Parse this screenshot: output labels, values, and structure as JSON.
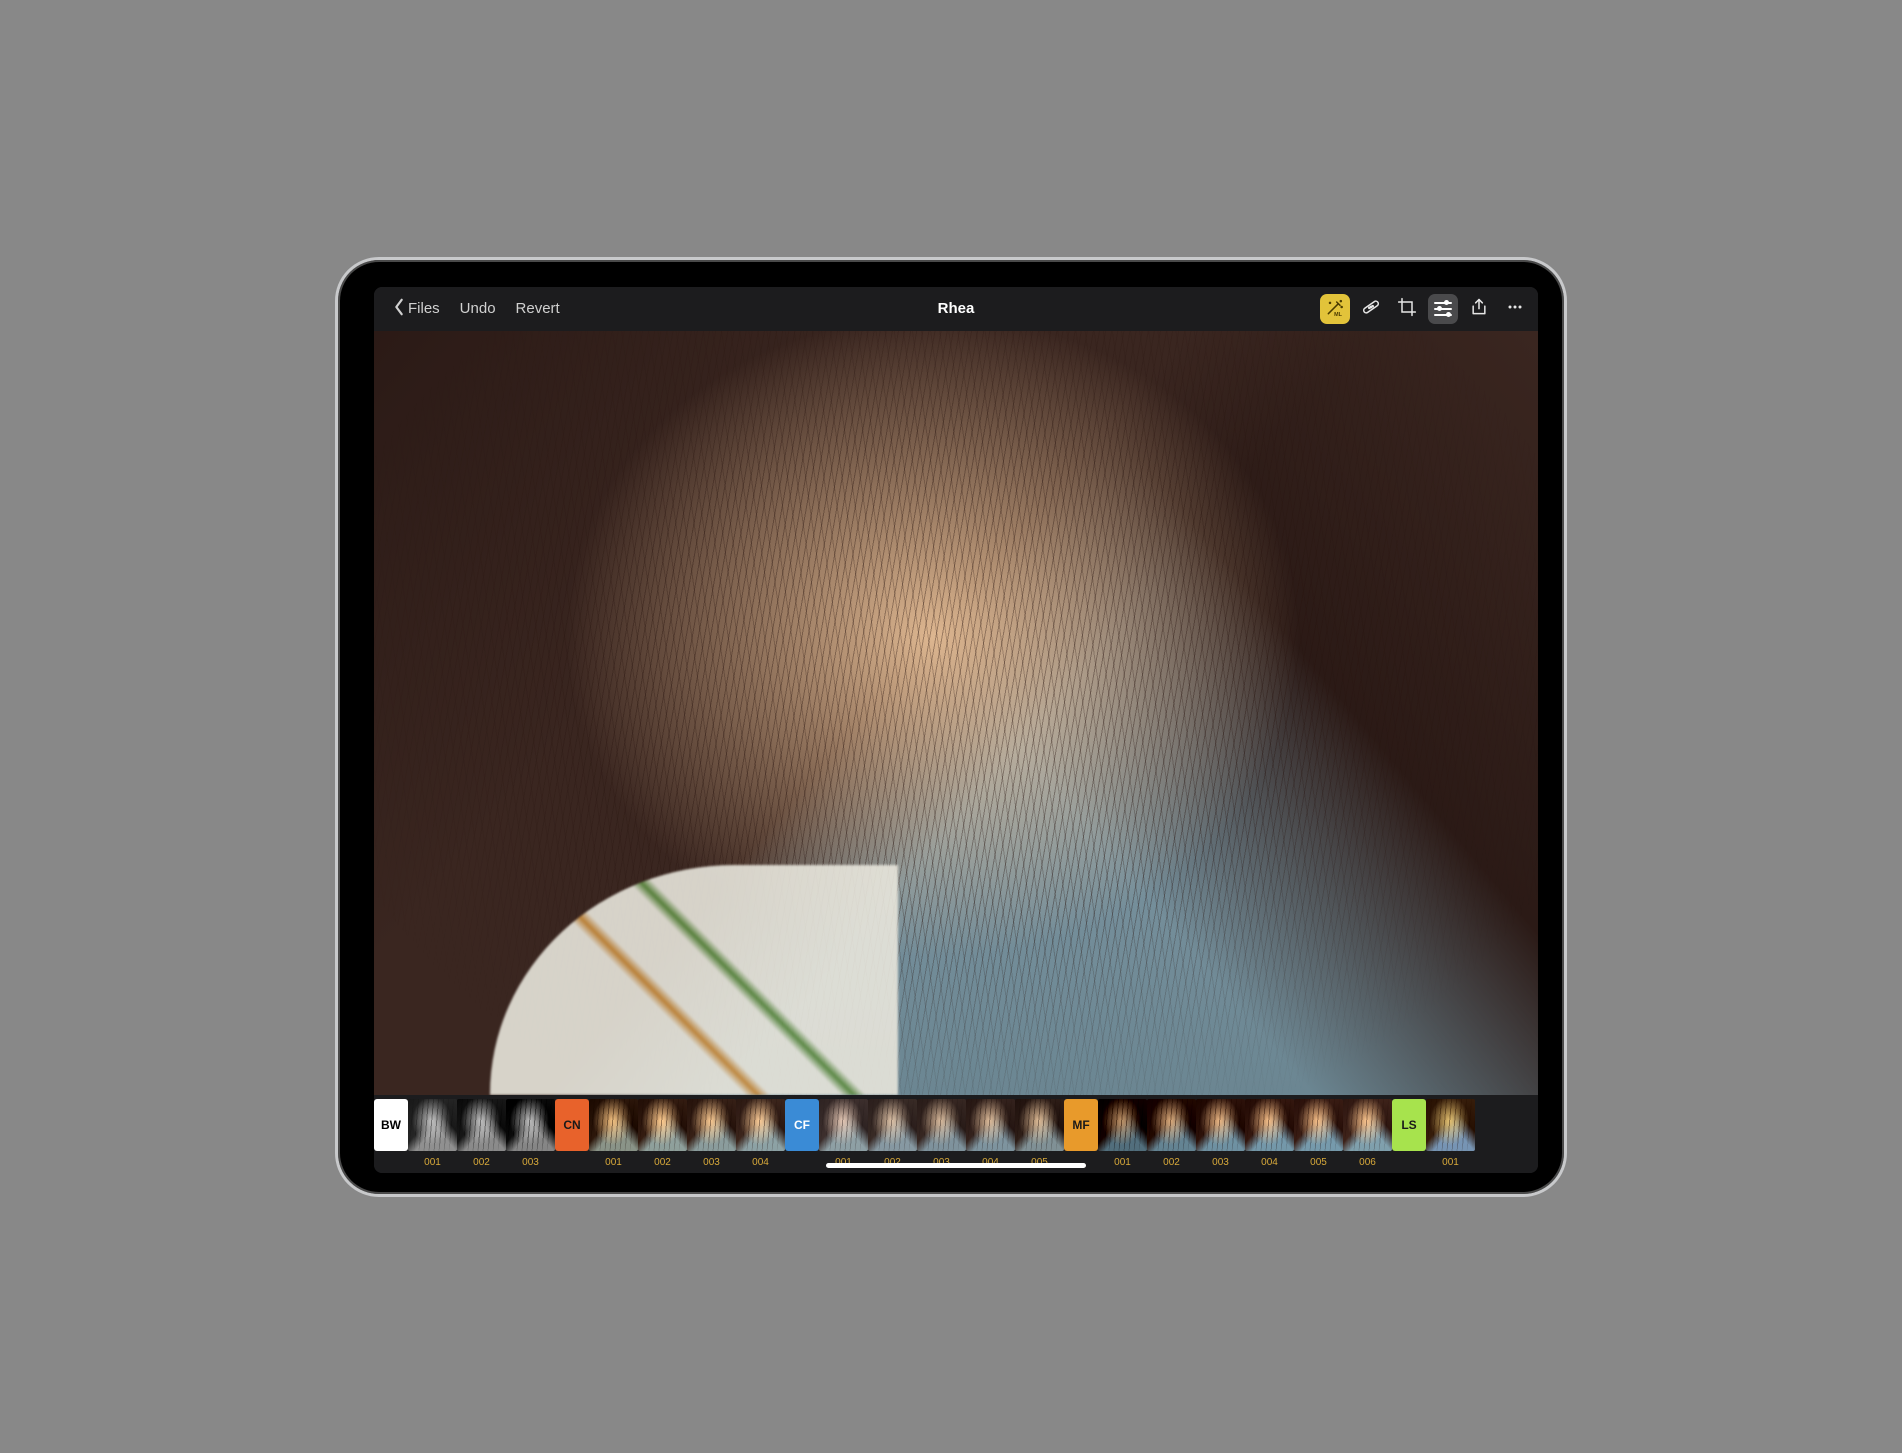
{
  "toolbar": {
    "back_label": "Files",
    "undo_label": "Undo",
    "revert_label": "Revert",
    "title": "Rhea",
    "ml_icon_text": "ML"
  },
  "presets": {
    "groups": [
      {
        "code": "BW",
        "color": "#ffffff",
        "text": "#000000",
        "items": [
          "001",
          "002",
          "003"
        ],
        "filters": [
          "grayscale(1) contrast(1.05)",
          "grayscale(1) contrast(1.2) brightness(0.95)",
          "grayscale(1) contrast(1.35) brightness(0.9)"
        ]
      },
      {
        "code": "CN",
        "color": "#e8622b",
        "text": "#1a1a1a",
        "items": [
          "001",
          "002",
          "003",
          "004"
        ],
        "filters": [
          "sepia(0.4) saturate(1.4) contrast(1.2) brightness(0.9)",
          "sepia(0.3) saturate(1.3) contrast(1.15)",
          "sepia(0.25) saturate(1.25) contrast(1.1)",
          "sepia(0.2) saturate(1.2) contrast(1.05) brightness(1.05)"
        ]
      },
      {
        "code": "CF",
        "color": "#3a8bd6",
        "text": "#ffffff",
        "items": [
          "001",
          "002",
          "003",
          "004",
          "005"
        ],
        "filters": [
          "saturate(0.6) brightness(1.1) contrast(0.95) hue-rotate(-8deg)",
          "saturate(0.7) brightness(1.05) contrast(0.98)",
          "saturate(0.8) brightness(1.0)",
          "saturate(0.85) contrast(1.05)",
          "saturate(0.9) contrast(1.1) brightness(0.95) sepia(0.15)"
        ]
      },
      {
        "code": "MF",
        "color": "#e89a2b",
        "text": "#1a1a1a",
        "items": [
          "001",
          "002",
          "003",
          "004",
          "005",
          "006"
        ],
        "filters": [
          "saturate(1.1) contrast(1.5) brightness(0.7)",
          "saturate(1.15) contrast(1.3) brightness(0.85)",
          "saturate(1.2) contrast(1.2) brightness(0.95)",
          "saturate(1.25) contrast(1.15)",
          "saturate(1.3) contrast(1.1) brightness(1.02)",
          "saturate(1.35) contrast(1.05) brightness(1.05) sepia(0.08)"
        ]
      },
      {
        "code": "LS",
        "color": "#a7e34d",
        "text": "#1a1a1a",
        "items": [
          "001"
        ],
        "filters": [
          "saturate(1.5) hue-rotate(15deg) contrast(1.1)"
        ]
      }
    ]
  }
}
